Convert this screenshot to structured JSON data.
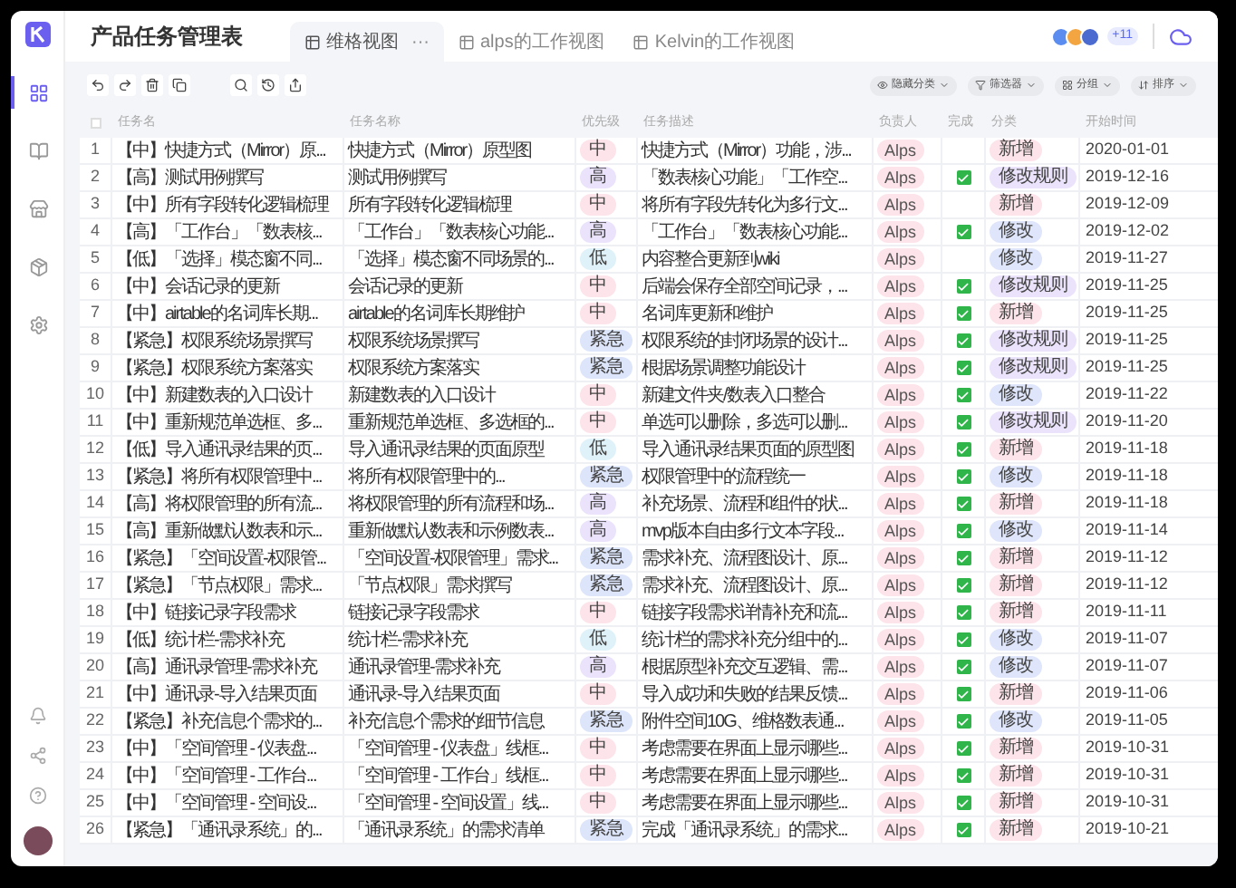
{
  "app": {
    "title": "产品任务管理表",
    "tabs": [
      {
        "label": "维格视图",
        "selected": true,
        "more": "···"
      },
      {
        "label": "alps的工作视图",
        "selected": false
      },
      {
        "label": "Kelvin的工作视图",
        "selected": false
      }
    ],
    "members_extra": "+11"
  },
  "sidebar": {
    "items": [
      {
        "selected": true
      },
      {
        "selected": false
      },
      {
        "selected": false
      },
      {
        "selected": false
      },
      {
        "selected": false
      }
    ]
  },
  "toolbar": {
    "buttons": [
      {
        "label": "隐藏分类"
      },
      {
        "label": "筛选器"
      },
      {
        "label": "分组"
      },
      {
        "label": "排序"
      }
    ]
  },
  "table": {
    "select_all": {
      "checked": false
    },
    "columns": [
      "任务名",
      "任务名称",
      "优先级",
      "任务描述",
      "负责人",
      "完成",
      "分类",
      "开始时间"
    ],
    "rows": [
      {
        "no": "1",
        "task": "【中】快捷方式（Mirror）原...",
        "title": "快捷方式（Mirror）原型图",
        "priority": {
          "label": "中",
          "color": "#fde4ea"
        },
        "description": "快捷方式（Mirror）功能，涉...",
        "owner": "Alps",
        "done": false,
        "category": {
          "label": "新增",
          "color": "#fde4ea"
        },
        "start": "2020-01-01"
      },
      {
        "no": "2",
        "task": "【高】测试用例撰写",
        "title": "测试用例撰写",
        "priority": {
          "label": "高",
          "color": "#ebe3fb"
        },
        "description": "「数表核心功能」「工作空...",
        "owner": "Alps",
        "done": true,
        "category": {
          "label": "修改规则",
          "color": "#ebe3fb"
        },
        "start": "2019-12-16"
      },
      {
        "no": "3",
        "task": "【中】所有字段转化逻辑梳理",
        "title": "所有字段转化逻辑梳理",
        "priority": {
          "label": "中",
          "color": "#fde4ea"
        },
        "description": "将所有字段先转化为多行文...",
        "owner": "Alps",
        "done": false,
        "category": {
          "label": "新增",
          "color": "#fde4ea"
        },
        "start": "2019-12-09"
      },
      {
        "no": "4",
        "task": "【高】「工作台」「数表核...",
        "title": "「工作台」「数表核心功能...",
        "priority": {
          "label": "高",
          "color": "#ebe3fb"
        },
        "description": "「工作台」「数表核心功能...",
        "owner": "Alps",
        "done": true,
        "category": {
          "label": "修改",
          "color": "#dfe6fb"
        },
        "start": "2019-12-02"
      },
      {
        "no": "5",
        "task": "【低】「选择」模态窗不同...",
        "title": "「选择」模态窗不同场景的...",
        "priority": {
          "label": "低",
          "color": "#dff2f9"
        },
        "description": "内容整合更新到wiki",
        "owner": "Alps",
        "done": false,
        "category": {
          "label": "修改",
          "color": "#dfe6fb"
        },
        "start": "2019-11-27"
      },
      {
        "no": "6",
        "task": "【中】会话记录的更新",
        "title": "会话记录的更新",
        "priority": {
          "label": "中",
          "color": "#fde4ea"
        },
        "description": "后端会保存全部空间记录，...",
        "owner": "Alps",
        "done": true,
        "category": {
          "label": "修改规则",
          "color": "#ebe3fb"
        },
        "start": "2019-11-25"
      },
      {
        "no": "7",
        "task": "【中】airtable的名词库长期...",
        "title": "airtable的名词库长期维护",
        "priority": {
          "label": "中",
          "color": "#fde4ea"
        },
        "description": "名词库更新和维护",
        "owner": "Alps",
        "done": true,
        "category": {
          "label": "新增",
          "color": "#fde4ea"
        },
        "start": "2019-11-25"
      },
      {
        "no": "8",
        "task": "【紧急】权限系统场景撰写",
        "title": "权限系统场景撰写",
        "priority": {
          "label": "紧急",
          "color": "#dde5fb"
        },
        "description": "权限系统的封闭场景的设计...",
        "owner": "Alps",
        "done": true,
        "category": {
          "label": "修改规则",
          "color": "#ebe3fb"
        },
        "start": "2019-11-25"
      },
      {
        "no": "9",
        "task": "【紧急】权限系统方案落实",
        "title": "权限系统方案落实",
        "priority": {
          "label": "紧急",
          "color": "#dde5fb"
        },
        "description": "根据场景调整功能设计",
        "owner": "Alps",
        "done": true,
        "category": {
          "label": "修改规则",
          "color": "#ebe3fb"
        },
        "start": "2019-11-25"
      },
      {
        "no": "10",
        "task": "【中】新建数表的入口设计",
        "title": "新建数表的入口设计",
        "priority": {
          "label": "中",
          "color": "#fde4ea"
        },
        "description": "新建文件夹/数表入口整合",
        "owner": "Alps",
        "done": true,
        "category": {
          "label": "修改",
          "color": "#dfe6fb"
        },
        "start": "2019-11-22"
      },
      {
        "no": "11",
        "task": "【中】重新规范单选框、多...",
        "title": "重新规范单选框、多选框的...",
        "priority": {
          "label": "中",
          "color": "#fde4ea"
        },
        "description": "单选可以删除，多选可以删...",
        "owner": "Alps",
        "done": true,
        "category": {
          "label": "修改规则",
          "color": "#ebe3fb"
        },
        "start": "2019-11-20"
      },
      {
        "no": "12",
        "task": "【低】导入通讯录结果的页...",
        "title": "导入通讯录结果的页面原型",
        "priority": {
          "label": "低",
          "color": "#dff2f9"
        },
        "description": "导入通讯录结果页面的原型图",
        "owner": "Alps",
        "done": true,
        "category": {
          "label": "新增",
          "color": "#fde4ea"
        },
        "start": "2019-11-18"
      },
      {
        "no": "13",
        "task": "【紧急】将所有权限管理中...",
        "title": "将所有权限管理中的...",
        "priority": {
          "label": "紧急",
          "color": "#dde5fb"
        },
        "description": "权限管理中的流程统一",
        "owner": "Alps",
        "done": true,
        "category": {
          "label": "修改",
          "color": "#dfe6fb"
        },
        "start": "2019-11-18"
      },
      {
        "no": "14",
        "task": "【高】将权限管理的所有流...",
        "title": "将权限管理的所有流程和场...",
        "priority": {
          "label": "高",
          "color": "#ebe3fb"
        },
        "description": "补充场景、流程和组件的状...",
        "owner": "Alps",
        "done": true,
        "category": {
          "label": "新增",
          "color": "#fde4ea"
        },
        "start": "2019-11-18"
      },
      {
        "no": "15",
        "task": "【高】重新做默认数表和示...",
        "title": "重新做默认数表和示例数表...",
        "priority": {
          "label": "高",
          "color": "#ebe3fb"
        },
        "description": "mvp版本自由多行文本字段...",
        "owner": "Alps",
        "done": true,
        "category": {
          "label": "修改",
          "color": "#dfe6fb"
        },
        "start": "2019-11-14"
      },
      {
        "no": "16",
        "task": "【紧急】「空间设置-权限管...",
        "title": "「空间设置-权限管理」需求...",
        "priority": {
          "label": "紧急",
          "color": "#dde5fb"
        },
        "description": "需求补充、流程图设计、原...",
        "owner": "Alps",
        "done": true,
        "category": {
          "label": "新增",
          "color": "#fde4ea"
        },
        "start": "2019-11-12"
      },
      {
        "no": "17",
        "task": "【紧急】「节点权限」需求...",
        "title": "「节点权限」需求撰写",
        "priority": {
          "label": "紧急",
          "color": "#dde5fb"
        },
        "description": "需求补充、流程图设计、原...",
        "owner": "Alps",
        "done": true,
        "category": {
          "label": "新增",
          "color": "#fde4ea"
        },
        "start": "2019-11-12"
      },
      {
        "no": "18",
        "task": "【中】链接记录字段需求",
        "title": "链接记录字段需求",
        "priority": {
          "label": "中",
          "color": "#fde4ea"
        },
        "description": "链接字段需求详情补充和流...",
        "owner": "Alps",
        "done": true,
        "category": {
          "label": "新增",
          "color": "#fde4ea"
        },
        "start": "2019-11-11"
      },
      {
        "no": "19",
        "task": "【低】统计栏-需求补充",
        "title": "统计栏-需求补充",
        "priority": {
          "label": "低",
          "color": "#dff2f9"
        },
        "description": "统计栏的需求补充分组中的...",
        "owner": "Alps",
        "done": true,
        "category": {
          "label": "修改",
          "color": "#dfe6fb"
        },
        "start": "2019-11-07"
      },
      {
        "no": "20",
        "task": "【高】通讯录管理-需求补充",
        "title": "通讯录管理-需求补充",
        "priority": {
          "label": "高",
          "color": "#ebe3fb"
        },
        "description": "根据原型补充交互逻辑、需...",
        "owner": "Alps",
        "done": true,
        "category": {
          "label": "修改",
          "color": "#dfe6fb"
        },
        "start": "2019-11-07"
      },
      {
        "no": "21",
        "task": "【中】通讯录-导入结果页面",
        "title": "通讯录-导入结果页面",
        "priority": {
          "label": "中",
          "color": "#fde4ea"
        },
        "description": "导入成功和失败的结果反馈...",
        "owner": "Alps",
        "done": true,
        "category": {
          "label": "新增",
          "color": "#fde4ea"
        },
        "start": "2019-11-06"
      },
      {
        "no": "22",
        "task": "【紧急】补充信息个需求的...",
        "title": "补充信息个需求的细节信息",
        "priority": {
          "label": "紧急",
          "color": "#dde5fb"
        },
        "description": "附件空间10G、维格数表通...",
        "owner": "Alps",
        "done": true,
        "category": {
          "label": "修改",
          "color": "#dfe6fb"
        },
        "start": "2019-11-05"
      },
      {
        "no": "23",
        "task": "【中】「空间管理 - 仪表盘...",
        "title": "「空间管理 - 仪表盘」线框...",
        "priority": {
          "label": "中",
          "color": "#fde4ea"
        },
        "description": "考虑需要在界面上显示哪些...",
        "owner": "Alps",
        "done": true,
        "category": {
          "label": "新增",
          "color": "#fde4ea"
        },
        "start": "2019-10-31"
      },
      {
        "no": "24",
        "task": "【中】「空间管理 - 工作台...",
        "title": "「空间管理 - 工作台」线框...",
        "priority": {
          "label": "中",
          "color": "#fde4ea"
        },
        "description": "考虑需要在界面上显示哪些...",
        "owner": "Alps",
        "done": true,
        "category": {
          "label": "新增",
          "color": "#fde4ea"
        },
        "start": "2019-10-31"
      },
      {
        "no": "25",
        "task": "【中】「空间管理 - 空间设...",
        "title": "「空间管理 - 空间设置」线...",
        "priority": {
          "label": "中",
          "color": "#fde4ea"
        },
        "description": "考虑需要在界面上显示哪些...",
        "owner": "Alps",
        "done": true,
        "category": {
          "label": "新增",
          "color": "#fde4ea"
        },
        "start": "2019-10-31"
      },
      {
        "no": "26",
        "task": "【紧急】「通讯录系统」的...",
        "title": "「通讯录系统」的需求清单",
        "priority": {
          "label": "紧急",
          "color": "#dde5fb"
        },
        "description": "完成「通讯录系统」的需求...",
        "owner": "Alps",
        "done": true,
        "category": {
          "label": "新增",
          "color": "#fde4ea"
        },
        "start": "2019-10-21"
      }
    ]
  }
}
